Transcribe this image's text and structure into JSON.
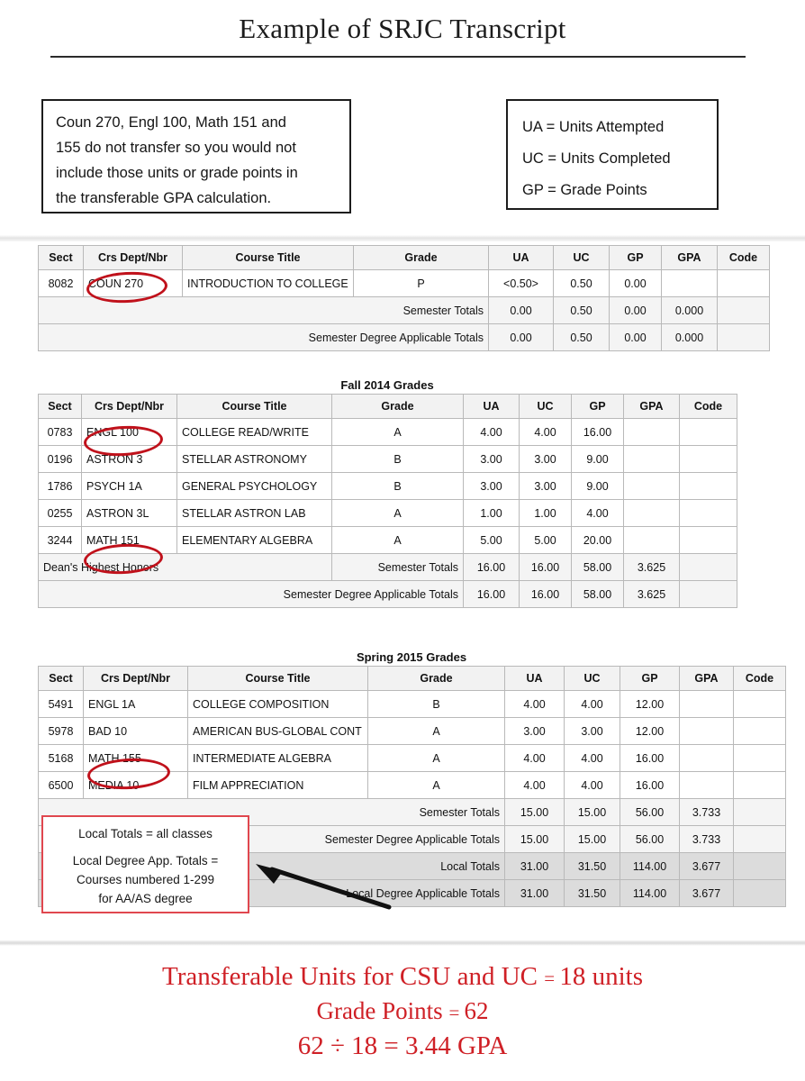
{
  "title": "Example of SRJC Transcript",
  "note_left": {
    "lines": [
      "Coun 270, Engl 100, Math 151 and",
      "155 do not transfer so you would not",
      "include those units or grade points in",
      "the transferable GPA calculation."
    ]
  },
  "legend": {
    "lines": [
      "UA = Units Attempted",
      "UC = Units Completed",
      "GP = Grade Points"
    ]
  },
  "columns": [
    "Sect",
    "Crs Dept/Nbr",
    "Course Title",
    "Grade",
    "UA",
    "UC",
    "GP",
    "GPA",
    "Code"
  ],
  "table1": {
    "caption": "",
    "rows": [
      {
        "sect": "8082",
        "crs": "COUN 270",
        "title": "INTRODUCTION TO COLLEGE",
        "grade": "P",
        "ua": "<0.50>",
        "uc": "0.50",
        "gp": "0.00",
        "gpa": "",
        "code": ""
      }
    ],
    "totals": [
      {
        "label": "Semester Totals",
        "ua": "0.00",
        "uc": "0.50",
        "gp": "0.00",
        "gpa": "0.000",
        "code": ""
      },
      {
        "label": "Semester Degree Applicable Totals",
        "ua": "0.00",
        "uc": "0.50",
        "gp": "0.00",
        "gpa": "0.000",
        "code": ""
      }
    ]
  },
  "table2": {
    "caption": "Fall 2014 Grades",
    "rows": [
      {
        "sect": "0783",
        "crs": "ENGL 100",
        "title": "COLLEGE READ/WRITE",
        "grade": "A",
        "ua": "4.00",
        "uc": "4.00",
        "gp": "16.00",
        "gpa": "",
        "code": ""
      },
      {
        "sect": "0196",
        "crs": "ASTRON 3",
        "title": "STELLAR ASTRONOMY",
        "grade": "B",
        "ua": "3.00",
        "uc": "3.00",
        "gp": "9.00",
        "gpa": "",
        "code": ""
      },
      {
        "sect": "1786",
        "crs": "PSYCH 1A",
        "title": "GENERAL PSYCHOLOGY",
        "grade": "B",
        "ua": "3.00",
        "uc": "3.00",
        "gp": "9.00",
        "gpa": "",
        "code": ""
      },
      {
        "sect": "0255",
        "crs": "ASTRON 3L",
        "title": "STELLAR ASTRON LAB",
        "grade": "A",
        "ua": "1.00",
        "uc": "1.00",
        "gp": "4.00",
        "gpa": "",
        "code": ""
      },
      {
        "sect": "3244",
        "crs": "MATH 151",
        "title": "ELEMENTARY ALGEBRA",
        "grade": "A",
        "ua": "5.00",
        "uc": "5.00",
        "gp": "20.00",
        "gpa": "",
        "code": ""
      }
    ],
    "honors": "Dean's Highest Honors",
    "totals": [
      {
        "label": "Semester Totals",
        "ua": "16.00",
        "uc": "16.00",
        "gp": "58.00",
        "gpa": "3.625",
        "code": ""
      },
      {
        "label": "Semester Degree Applicable Totals",
        "ua": "16.00",
        "uc": "16.00",
        "gp": "58.00",
        "gpa": "3.625",
        "code": ""
      }
    ]
  },
  "table3": {
    "caption": "Spring 2015 Grades",
    "rows": [
      {
        "sect": "5491",
        "crs": "ENGL 1A",
        "title": "COLLEGE COMPOSITION",
        "grade": "B",
        "ua": "4.00",
        "uc": "4.00",
        "gp": "12.00",
        "gpa": "",
        "code": ""
      },
      {
        "sect": "5978",
        "crs": "BAD 10",
        "title": "AMERICAN BUS-GLOBAL CONT",
        "grade": "A",
        "ua": "3.00",
        "uc": "3.00",
        "gp": "12.00",
        "gpa": "",
        "code": ""
      },
      {
        "sect": "5168",
        "crs": "MATH 155",
        "title": "INTERMEDIATE ALGEBRA",
        "grade": "A",
        "ua": "4.00",
        "uc": "4.00",
        "gp": "16.00",
        "gpa": "",
        "code": ""
      },
      {
        "sect": "6500",
        "crs": "MEDIA 10",
        "title": "FILM APPRECIATION",
        "grade": "A",
        "ua": "4.00",
        "uc": "4.00",
        "gp": "16.00",
        "gpa": "",
        "code": ""
      }
    ],
    "totals": [
      {
        "label": "Semester Totals",
        "ua": "15.00",
        "uc": "15.00",
        "gp": "56.00",
        "gpa": "3.733",
        "code": "",
        "dark": false
      },
      {
        "label": "Semester Degree Applicable Totals",
        "ua": "15.00",
        "uc": "15.00",
        "gp": "56.00",
        "gpa": "3.733",
        "code": "",
        "dark": false
      },
      {
        "label": "Local Totals",
        "ua": "31.00",
        "uc": "31.50",
        "gp": "114.00",
        "gpa": "3.677",
        "code": "",
        "dark": true
      },
      {
        "label": "Local Degree Applicable Totals",
        "ua": "31.00",
        "uc": "31.50",
        "gp": "114.00",
        "gpa": "3.677",
        "code": "",
        "dark": true
      }
    ]
  },
  "local_note": {
    "lines": [
      "Local Totals = all classes",
      "Local Degree App. Totals =",
      "Courses numbered 1-299",
      "for AA/AS degree"
    ]
  },
  "footer": {
    "line1_a": "Transferable Units for CSU and UC ",
    "line1_eq": "= ",
    "line1_b": "18 units",
    "line2_a": "Grade Points ",
    "line2_eq": "= ",
    "line2_b": "62",
    "line3": "62 ÷ 18 = 3.44 GPA"
  },
  "colors": {
    "annotation_red": "#c0111b",
    "footer_red": "#cf2026",
    "header_bg": "#f2f2f2",
    "total_bg": "#f4f4f4",
    "total_dark_bg": "#dcdcdc"
  }
}
